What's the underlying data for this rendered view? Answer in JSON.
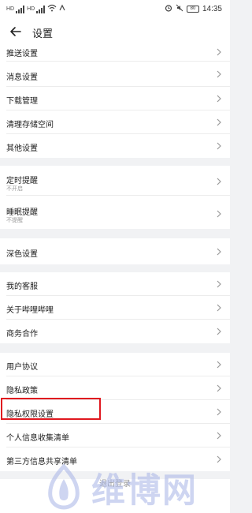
{
  "status_bar": {
    "carrier_1": "HD",
    "carrier_2": "HD",
    "time": "14:35",
    "battery": "80"
  },
  "header": {
    "title": "设置"
  },
  "groups": {
    "g1": [
      "推送设置",
      "消息设置",
      "下载管理",
      "清理存储空间",
      "其他设置"
    ],
    "g2": [
      {
        "label": "定时提醒",
        "sub": "不开启"
      },
      {
        "label": "睡眠提醒",
        "sub": "不提醒"
      }
    ],
    "g3": [
      "深色设置"
    ],
    "g4": [
      "我的客服",
      "关于哔哩哔哩",
      "商务合作"
    ],
    "g5": [
      "用户协议",
      "隐私政策",
      "隐私权限设置",
      "个人信息收集清单",
      "第三方信息共享清单"
    ]
  },
  "logout_label": "退出登录",
  "watermark": "维博网",
  "colors": {
    "highlight": "#e0181f",
    "page_bg": "#f1f2f4"
  }
}
